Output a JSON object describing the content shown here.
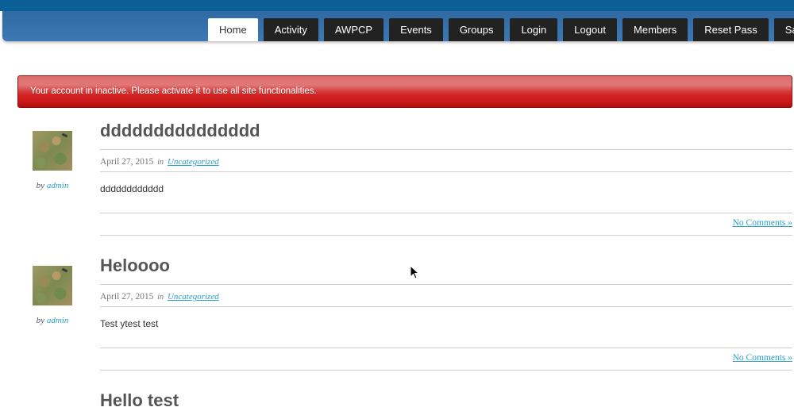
{
  "nav": {
    "tabs": [
      {
        "label": "Home",
        "active": true
      },
      {
        "label": "Activity"
      },
      {
        "label": "AWPCP"
      },
      {
        "label": "Events"
      },
      {
        "label": "Groups"
      },
      {
        "label": "Login"
      },
      {
        "label": "Logout"
      },
      {
        "label": "Members"
      },
      {
        "label": "Reset Pass"
      },
      {
        "label": "Sample"
      }
    ]
  },
  "alert": {
    "text": "Your account in inactive. Please activate it to use all site functionalities."
  },
  "posts": [
    {
      "title": "ddddddddddddddd",
      "date": "April 27, 2015",
      "in_label": "in",
      "category": "Uncategorized",
      "by_label": "by",
      "author": "admin",
      "body": "dddddddddddd",
      "comments": "No Comments »"
    },
    {
      "title": "Heloooo",
      "date": "April 27, 2015",
      "in_label": "in",
      "category": "Uncategorized",
      "by_label": "by",
      "author": "admin",
      "body": "Test ytest test",
      "comments": "No Comments »"
    },
    {
      "title": "Hello test"
    }
  ],
  "colors": {
    "header_dark": "#0b5f97",
    "header": "#3d78b3",
    "nav_tab": "#222222",
    "alert_red": "#d42222",
    "link": "#2a9fc9"
  }
}
